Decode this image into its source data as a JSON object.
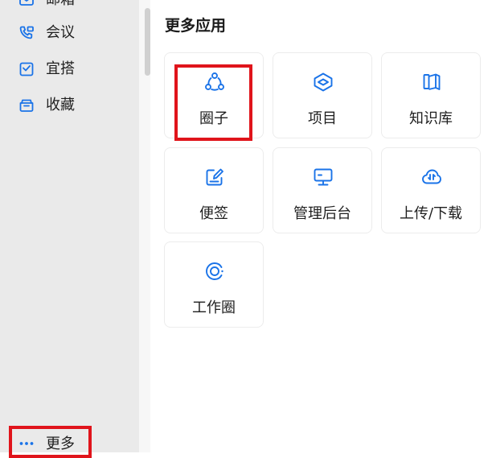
{
  "sidebar": {
    "items": [
      {
        "label": "邮箱",
        "icon": "mail-icon"
      },
      {
        "label": "会议",
        "icon": "phone-meeting-icon"
      },
      {
        "label": "宜搭",
        "icon": "form-builder-icon"
      },
      {
        "label": "收藏",
        "icon": "folder-favorites-icon"
      }
    ],
    "more": {
      "label": "更多",
      "icon": "ellipsis-icon"
    }
  },
  "panel": {
    "title": "更多应用",
    "apps": [
      {
        "label": "圈子",
        "icon": "circle-group-icon",
        "highlighted": true
      },
      {
        "label": "项目",
        "icon": "project-layers-icon"
      },
      {
        "label": "知识库",
        "icon": "book-icon"
      },
      {
        "label": "便签",
        "icon": "note-edit-icon"
      },
      {
        "label": "管理后台",
        "icon": "monitor-icon"
      },
      {
        "label": "上传/下载",
        "icon": "cloud-transfer-icon"
      },
      {
        "label": "工作圈",
        "icon": "work-circle-icon"
      }
    ]
  },
  "colors": {
    "accent": "#1a73e8",
    "highlight": "#e0141b",
    "sidebar_bg": "#eaeaea"
  }
}
